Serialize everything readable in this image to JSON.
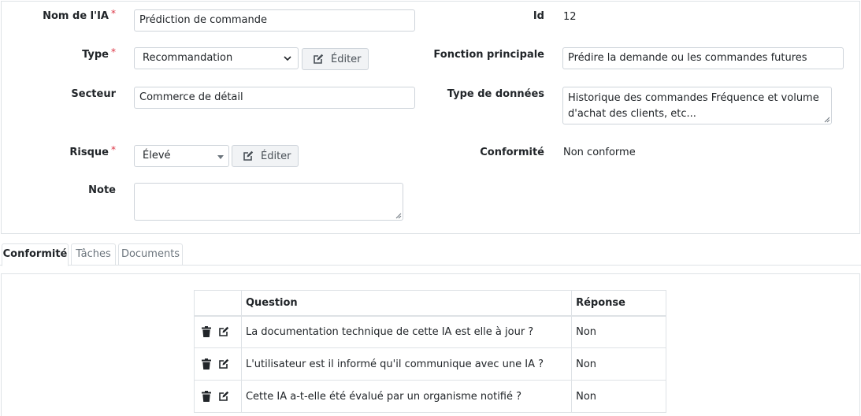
{
  "form": {
    "name_label": "Nom de l'IA",
    "name_value": "Prédiction de commande",
    "type_label": "Type",
    "type_value": "Recommandation",
    "type_edit": "Éditer",
    "sector_label": "Secteur",
    "sector_value": "Commerce de détail",
    "risk_label": "Risque",
    "risk_value": "Élevé",
    "risk_edit": "Éditer",
    "note_label": "Note",
    "note_value": "",
    "required_mark": "*",
    "id_label": "Id",
    "id_value": "12",
    "function_label": "Fonction principale",
    "function_value": "Prédire la demande ou les commandes futures",
    "data_type_label": "Type de données",
    "data_type_line1": "Historique des commandes Fréquence et volume",
    "data_type_line2": "d'achat des clients, etc...",
    "compliance_label": "Conformité",
    "compliance_value": "Non conforme"
  },
  "tabs": [
    {
      "label": "Conformité",
      "active": true
    },
    {
      "label": "Tâches",
      "active": false
    },
    {
      "label": "Documents",
      "active": false
    }
  ],
  "table": {
    "headers": [
      "",
      "Question",
      "Réponse"
    ],
    "rows": [
      {
        "question": "La documentation technique de cette IA est elle à jour ?",
        "answer": "Non"
      },
      {
        "question": "L'utilisateur est il informé qu'il communique avec une IA ?",
        "answer": "Non"
      },
      {
        "question": "Cette IA a-t-elle été évalué par un organisme notifié ?",
        "answer": "Non"
      }
    ]
  },
  "icons": {
    "trash": "trash-icon",
    "edit": "edit-icon",
    "chevron": "chevron-down-icon"
  },
  "colors": {
    "required": "#dc3545",
    "border": "#dee2e6",
    "button_bg": "#f1f3f5"
  }
}
